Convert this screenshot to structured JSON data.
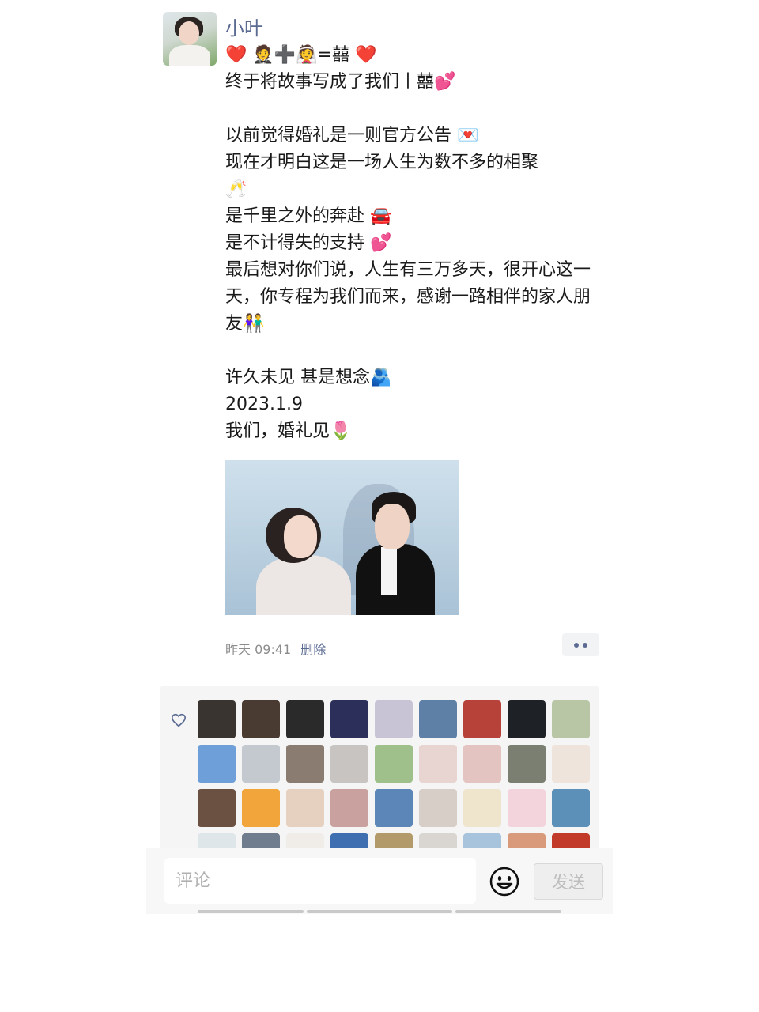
{
  "post": {
    "author": "小叶",
    "text": "❤️ 🤵➕👰=囍 ❤️\n终于将故事写成了我们丨囍💕\n\n以前觉得婚礼是一则官方公告 💌\n现在才明白这是一场人生为数不多的相聚\n🥂\n是千里之外的奔赴 🚘\n是不计得失的支持 💕\n最后想对你们说，人生有三万多天，很开心这一天，你专程为我们而来，感谢一路相伴的家人朋友👫\n\n许久未见 甚是想念🫂\n2023.1.9\n我们，婚礼见🌷",
    "time": "昨天 09:41",
    "delete_label": "删除"
  },
  "likes": {
    "icon": "heart-outline-icon",
    "avatar_colors": [
      "#3a3431",
      "#4a3b32",
      "#2a2a2a",
      "#2b2f5a",
      "#c9c3d6",
      "#5e7fa6",
      "#b7423a",
      "#1e2226",
      "#b8c6a6",
      "#6f9fd8",
      "#c4c9cf",
      "#8a7c70",
      "#c8c4c2",
      "#9fc08a",
      "#e8d4d0",
      "#e3c4c0",
      "#7a7f72",
      "#efe4dc",
      "#6b5142",
      "#f2a53b",
      "#e6d0c0",
      "#c9a2a0",
      "#5d86b8",
      "#d8cec8",
      "#efe4cc",
      "#f3d4dc",
      "#5d90b8",
      "#dfe6ea",
      "#6f7d8f",
      "#f0ece8",
      "#3f6fb0",
      "#b39a6a",
      "#d9d6d2",
      "#a8c4dc",
      "#d89a7a",
      "#c23a2a"
    ]
  },
  "comment_bar": {
    "placeholder": "评论",
    "emoji_icon": "emoji-face-icon",
    "send_label": "发送"
  }
}
